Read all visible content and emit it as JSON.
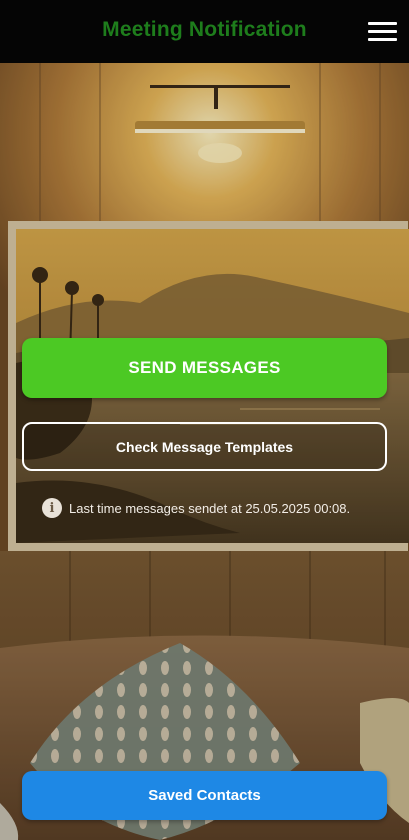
{
  "app_bar": {
    "title": "Meeting Notification",
    "menu_icon": "hamburger-menu-icon"
  },
  "actions": {
    "send_label": "SEND MESSAGES",
    "templates_label": "Check Message Templates",
    "contacts_label": "Saved Contacts"
  },
  "status": {
    "info_icon": "info-icon",
    "info_glyph": "i",
    "last_sent_text": "Last time messages sendet at 25.05.2025 00:08."
  },
  "colors": {
    "title": "#1e7d1c",
    "app_bar_bg": "#050505",
    "send_button": "#4cc924",
    "contacts_button": "#1e88e5"
  }
}
